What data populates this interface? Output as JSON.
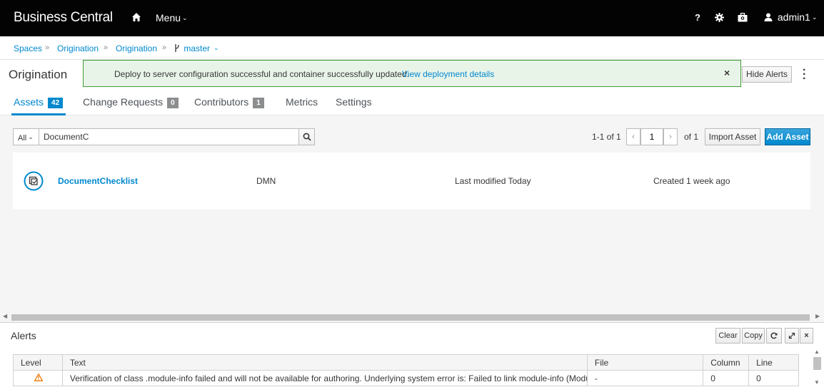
{
  "topbar": {
    "brand": "Business Central",
    "menu_label": "Menu",
    "help_label": "?",
    "user_label": "admin1"
  },
  "breadcrumb": {
    "items": [
      "Spaces",
      "Origination",
      "Origination"
    ],
    "separator": "»",
    "branch": "master"
  },
  "page": {
    "title": "Origination",
    "hide_alerts_label": "Hide Alerts"
  },
  "notification": {
    "message": "Deploy to server configuration successful and container successfully updated.",
    "link": "View deployment details",
    "close_glyph": "×"
  },
  "tabs": [
    {
      "label": "Assets",
      "badge": "42",
      "active": true
    },
    {
      "label": "Change Requests",
      "badge": "0"
    },
    {
      "label": "Contributors",
      "badge": "1"
    },
    {
      "label": "Metrics"
    },
    {
      "label": "Settings"
    }
  ],
  "toolbar": {
    "filter_label": "All",
    "search_value": "DocumentC",
    "pager_range": "1-1 of 1",
    "page_value": "1",
    "page_of": "of 1",
    "import_label": "Import Asset",
    "add_label": "Add Asset"
  },
  "assets": [
    {
      "name": "DocumentChecklist",
      "type": "DMN",
      "modified": "Last modified Today",
      "created": "Created 1 week ago"
    }
  ],
  "alerts_panel": {
    "title": "Alerts",
    "clear_label": "Clear",
    "copy_label": "Copy",
    "columns": [
      "Level",
      "Text",
      "File",
      "Column",
      "Line"
    ],
    "rows": [
      {
        "level": "warning",
        "text": "Verification of class .module-info failed and will not be available for authoring. Underlying system error is: Failed to link module-info (Module ...",
        "file": "-",
        "column": "0",
        "line": "0"
      }
    ]
  },
  "colors": {
    "accent": "#0088ce",
    "success_border": "#3f9c35",
    "success_bg": "#e9f4e9",
    "warning": "#ec7a08"
  },
  "icons": [
    "home-icon",
    "help-icon",
    "gear-icon",
    "briefcase-icon",
    "user-icon",
    "branch-icon",
    "search-icon",
    "dmn-icon",
    "refresh-icon",
    "expand-icon",
    "close-icon",
    "warning-icon",
    "kebab-icon"
  ]
}
